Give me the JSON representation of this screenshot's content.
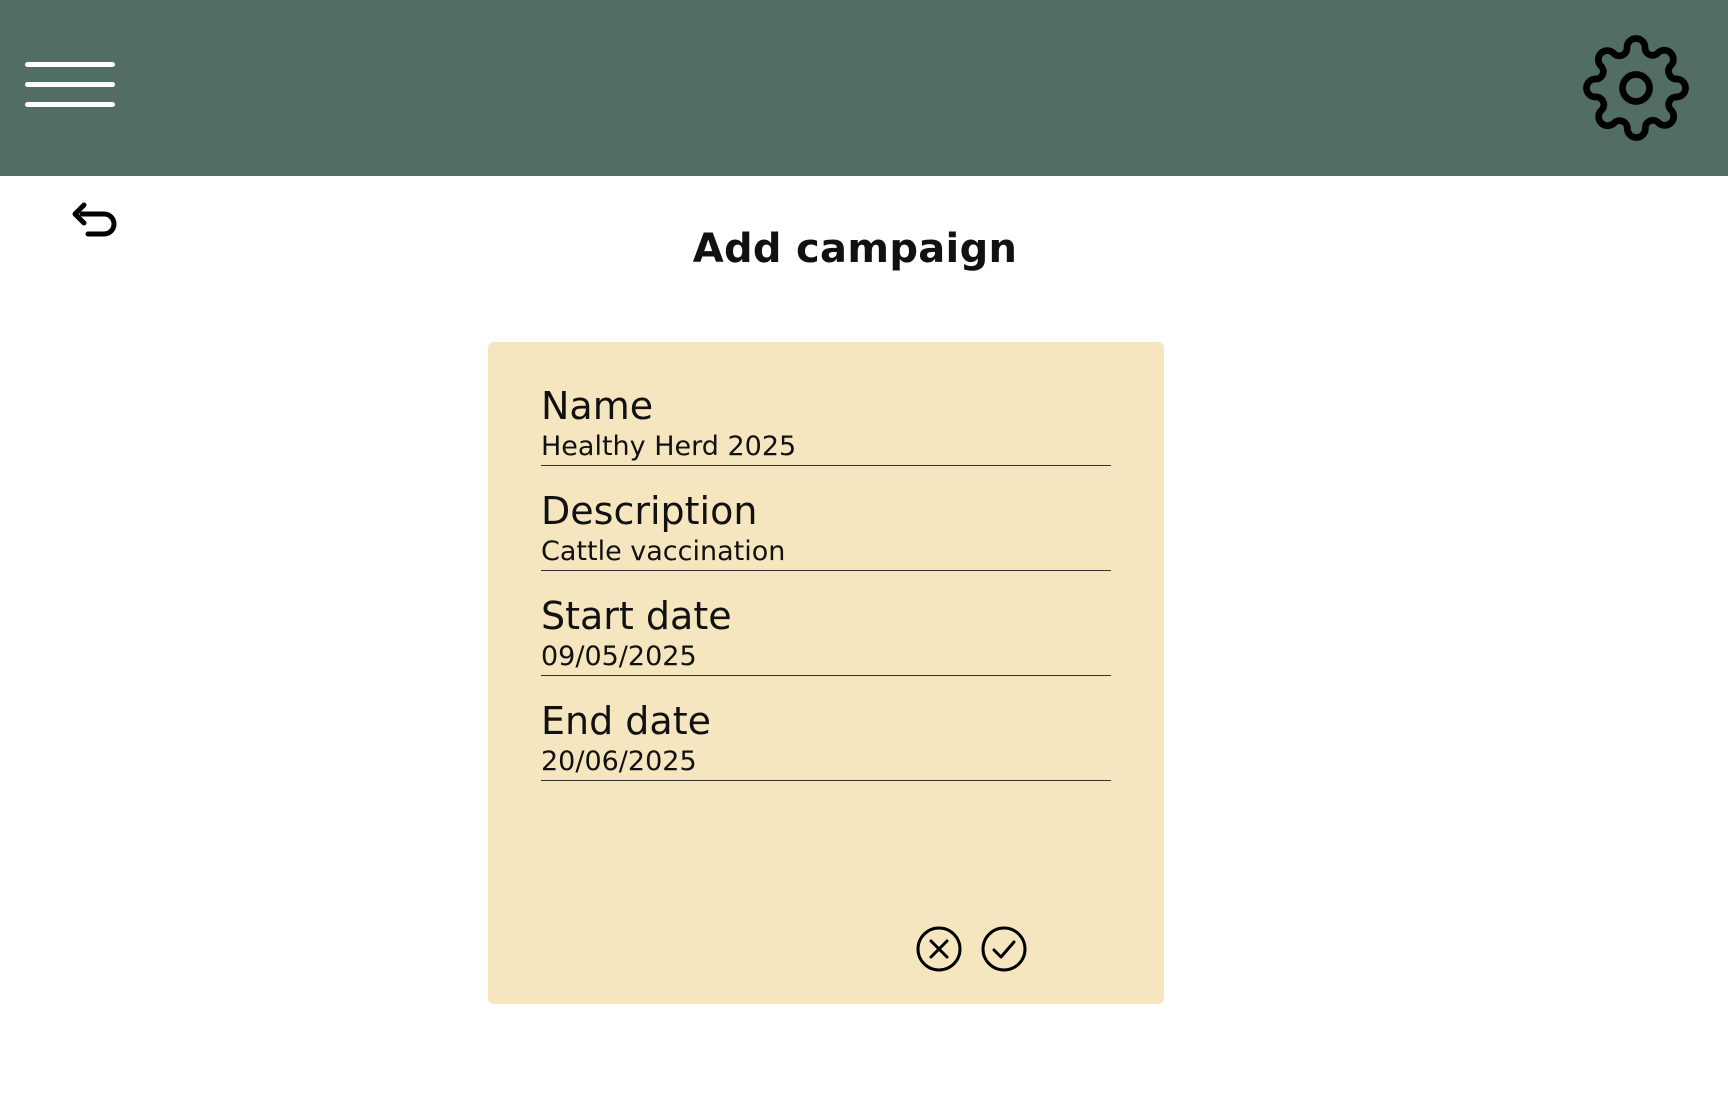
{
  "header": {
    "menu_icon": "hamburger-menu-icon",
    "settings_icon": "gear-icon",
    "background_color": "#516d65"
  },
  "nav": {
    "back_icon": "undo-arrow-icon"
  },
  "page": {
    "title": "Add campaign"
  },
  "form": {
    "background_color": "#f6e6bf",
    "fields": [
      {
        "label": "Name",
        "value": "Healthy Herd 2025"
      },
      {
        "label": "Description",
        "value": "Cattle vaccination"
      },
      {
        "label": "Start date",
        "value": "09/05/2025"
      },
      {
        "label": "End date",
        "value": "20/06/2025"
      }
    ],
    "actions": {
      "cancel_icon": "circle-x-icon",
      "confirm_icon": "circle-check-icon"
    }
  }
}
